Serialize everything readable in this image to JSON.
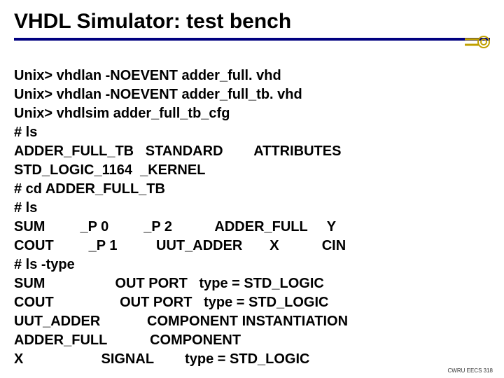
{
  "title": "VHDL Simulator: test bench",
  "footer": "CWRU EECS 318",
  "lines": {
    "l0": "Unix> vhdlan -NOEVENT adder_full. vhd",
    "l1": "Unix> vhdlan -NOEVENT adder_full_tb. vhd",
    "l2": "Unix> vhdlsim adder_full_tb_cfg",
    "l3": "# ls",
    "l4": "ADDER_FULL_TB   STANDARD        ATTRIBUTES",
    "l5": "STD_LOGIC_1164  _KERNEL",
    "l6": "# cd ADDER_FULL_TB",
    "l7": "# ls",
    "l8": "SUM         _P 0         _P 2           ADDER_FULL     Y",
    "l9": "COUT         _P 1          UUT_ADDER       X           CIN",
    "l10": "# ls -type",
    "l11": "SUM                  OUT PORT   type = STD_LOGIC",
    "l12": "COUT                 OUT PORT   type = STD_LOGIC",
    "l13": "UUT_ADDER            COMPONENT INSTANTIATION",
    "l14": "ADDER_FULL           COMPONENT",
    "l15": "X                    SIGNAL        type = STD_LOGIC"
  }
}
